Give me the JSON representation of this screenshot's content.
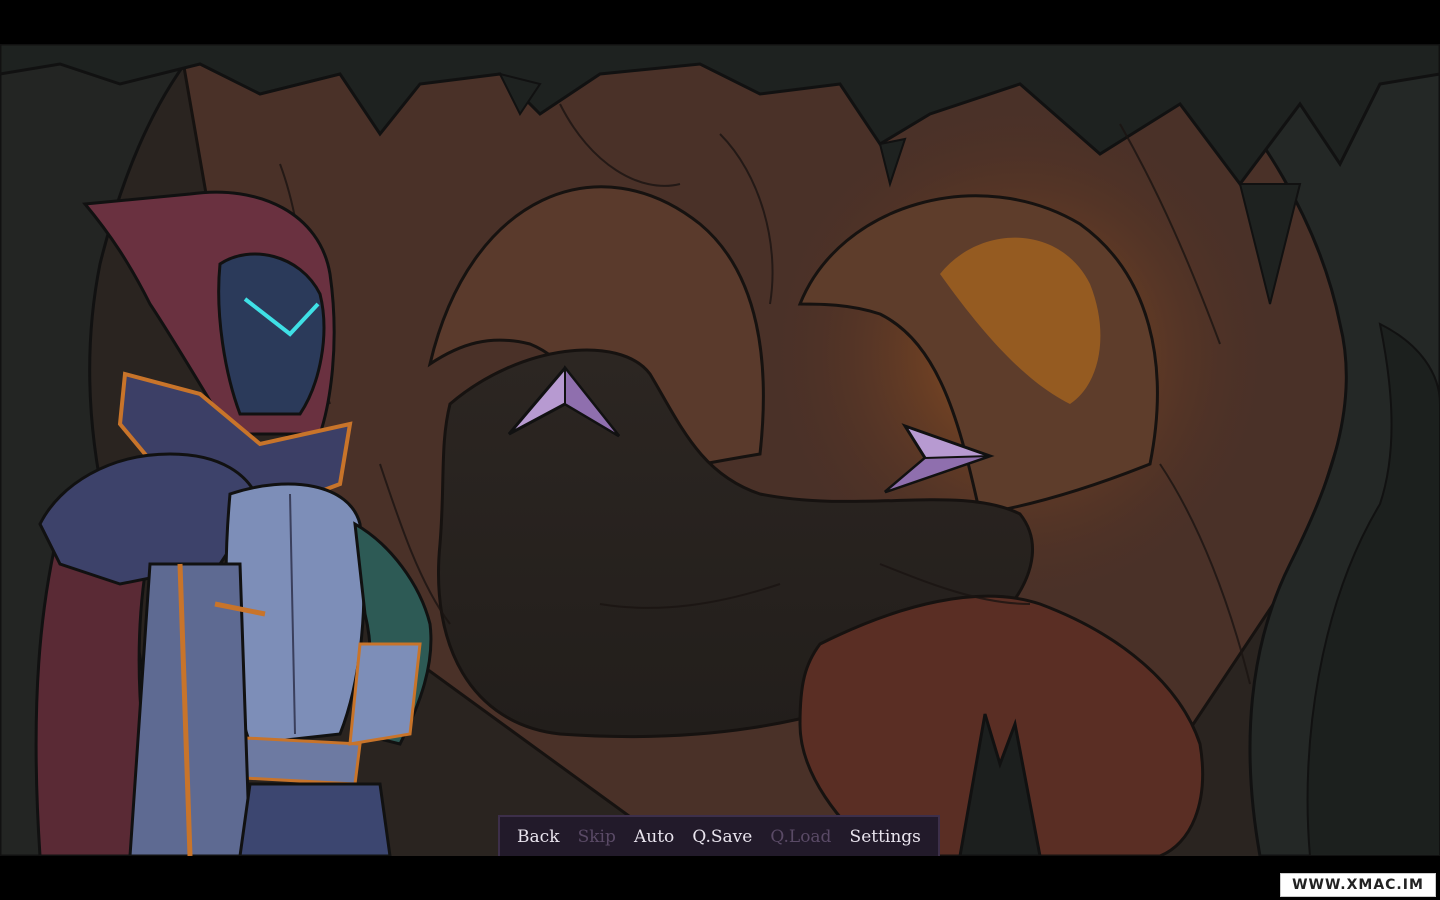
{
  "quick_menu": {
    "items": [
      {
        "label": "Back",
        "enabled": true
      },
      {
        "label": "Skip",
        "enabled": false
      },
      {
        "label": "Auto",
        "enabled": true
      },
      {
        "label": "Q.Save",
        "enabled": true
      },
      {
        "label": "Q.Load",
        "enabled": false
      },
      {
        "label": "Settings",
        "enabled": true
      }
    ]
  },
  "watermark": {
    "text": "WWW.XMAC.IM"
  },
  "scene": {
    "location": "cave",
    "navigation_arrows": [
      {
        "icon": "arrow-up-left-icon",
        "direction": "up"
      },
      {
        "icon": "arrow-right-icon",
        "direction": "right"
      }
    ]
  },
  "colors": {
    "menu_bg": "#221a2a",
    "menu_text": "#e9e4ee",
    "menu_text_disabled": "#5a4a66",
    "arrow_fill": "#b79ad1",
    "cave_glow": "#c47a1e",
    "visor_glow": "#3fe0e6"
  }
}
